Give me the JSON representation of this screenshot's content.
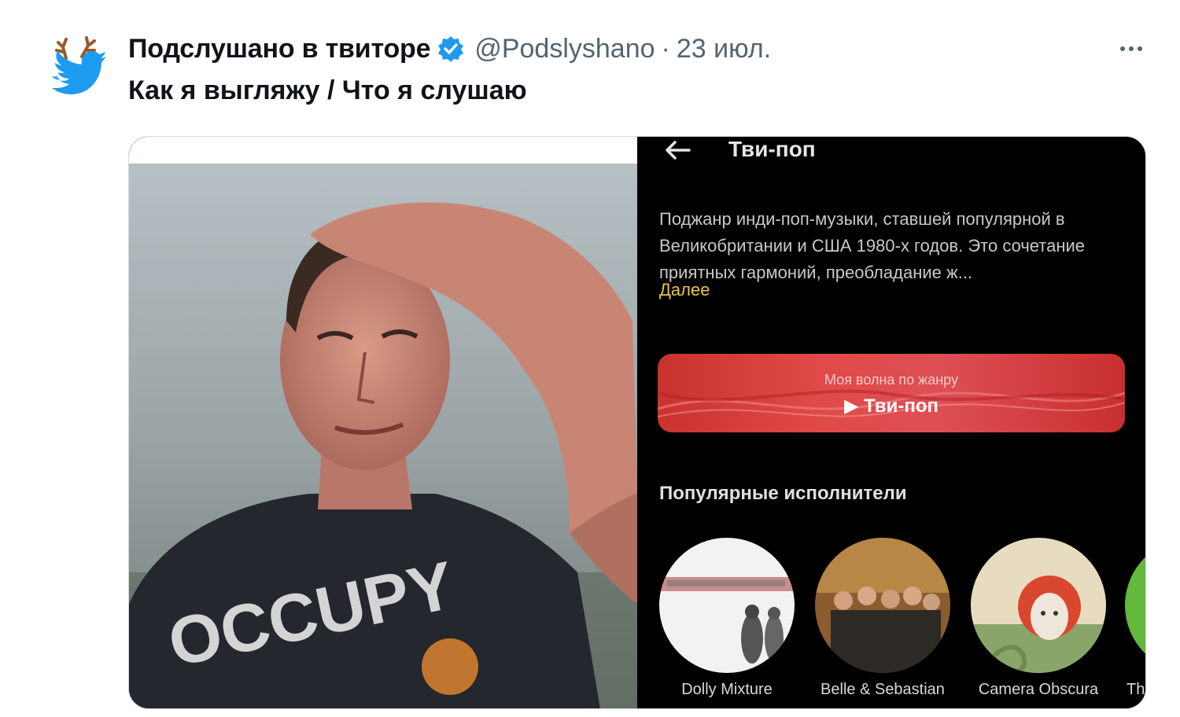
{
  "tweet": {
    "author_name": "Подслушано в твиторе",
    "handle": "@Podslyshano",
    "separator": "·",
    "date": "23 июл.",
    "text": "Как я выгляжу / Что я слушаю",
    "verified": true,
    "icons": {
      "avatar": "twitter-bird-with-antlers-icon",
      "verified": "verified-badge-icon",
      "more": "more-options-icon"
    },
    "colors": {
      "verified": "#1d9bf0",
      "avatar_bird": "#1d9bf0",
      "secondary_text": "#536471"
    }
  },
  "media": {
    "photo": {
      "description_tags": [
        "portrait",
        "t-shirt"
      ],
      "shirt_text": "OCCUPY MARS"
    },
    "app_screen": {
      "title": "Тви-поп",
      "back_icon": "arrow-left-icon",
      "description": "Поджанр инди-поп-музыки, ставшей популярной в Великобритании и США 1980-х годов. Это сочетание приятных гармоний, преобладание ж...",
      "more_link": "Далее",
      "wave_button": {
        "subtitle": "Моя волна по жанру",
        "title": "▶ Тви-поп"
      },
      "section_title": "Популярные исполнители",
      "artists": [
        {
          "name": "Dolly Mixture"
        },
        {
          "name": "Belle & Sebastian"
        },
        {
          "name": "Camera Obscura"
        },
        {
          "name": "Th"
        }
      ],
      "colors": {
        "background": "#000000",
        "accent_link": "#e8c34a",
        "wave_button": "#d9403f"
      }
    }
  }
}
